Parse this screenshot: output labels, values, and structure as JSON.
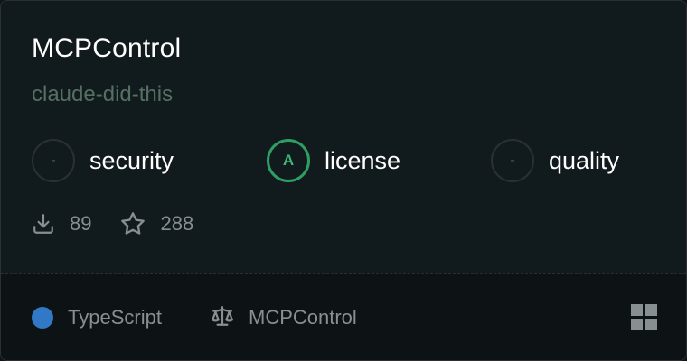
{
  "card": {
    "title": "MCPControl",
    "owner": "claude-did-this",
    "scores": [
      {
        "grade": "-",
        "label": "security",
        "icon": "empty-grade-circle"
      },
      {
        "grade": "A",
        "label": "license",
        "icon": "grade-a-circle"
      },
      {
        "grade": "-",
        "label": "quality",
        "icon": "empty-grade-circle"
      }
    ],
    "stats": {
      "downloads": "89",
      "stars": "288"
    },
    "footer": {
      "language": "TypeScript",
      "language_color": "#3178c6",
      "license": "MCPControl"
    },
    "colors": {
      "grade_accent": "#2f9e62",
      "owner_text": "#557062"
    }
  }
}
